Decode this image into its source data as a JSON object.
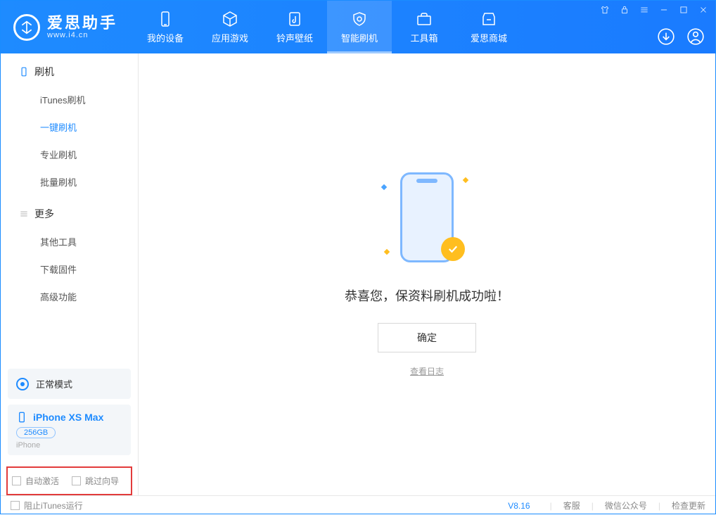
{
  "app": {
    "name": "爱思助手",
    "url": "www.i4.cn"
  },
  "nav": {
    "tabs": [
      {
        "label": "我的设备"
      },
      {
        "label": "应用游戏"
      },
      {
        "label": "铃声壁纸"
      },
      {
        "label": "智能刷机"
      },
      {
        "label": "工具箱"
      },
      {
        "label": "爱思商城"
      }
    ],
    "active_index": 3
  },
  "sidebar": {
    "group1": {
      "title": "刷机",
      "items": [
        "iTunes刷机",
        "一键刷机",
        "专业刷机",
        "批量刷机"
      ],
      "active_index": 1
    },
    "group2": {
      "title": "更多",
      "items": [
        "其他工具",
        "下载固件",
        "高级功能"
      ]
    },
    "mode_card": {
      "label": "正常模式"
    },
    "device_card": {
      "name": "iPhone XS Max",
      "capacity": "256GB",
      "sub": "iPhone"
    },
    "options": {
      "auto_activate": "自动激活",
      "skip_guide": "跳过向导"
    }
  },
  "main": {
    "success_msg": "恭喜您，保资料刷机成功啦！",
    "ok_label": "确定",
    "log_link": "查看日志"
  },
  "statusbar": {
    "block_itunes": "阻止iTunes运行",
    "version": "V8.16",
    "links": [
      "客服",
      "微信公众号",
      "检查更新"
    ]
  }
}
